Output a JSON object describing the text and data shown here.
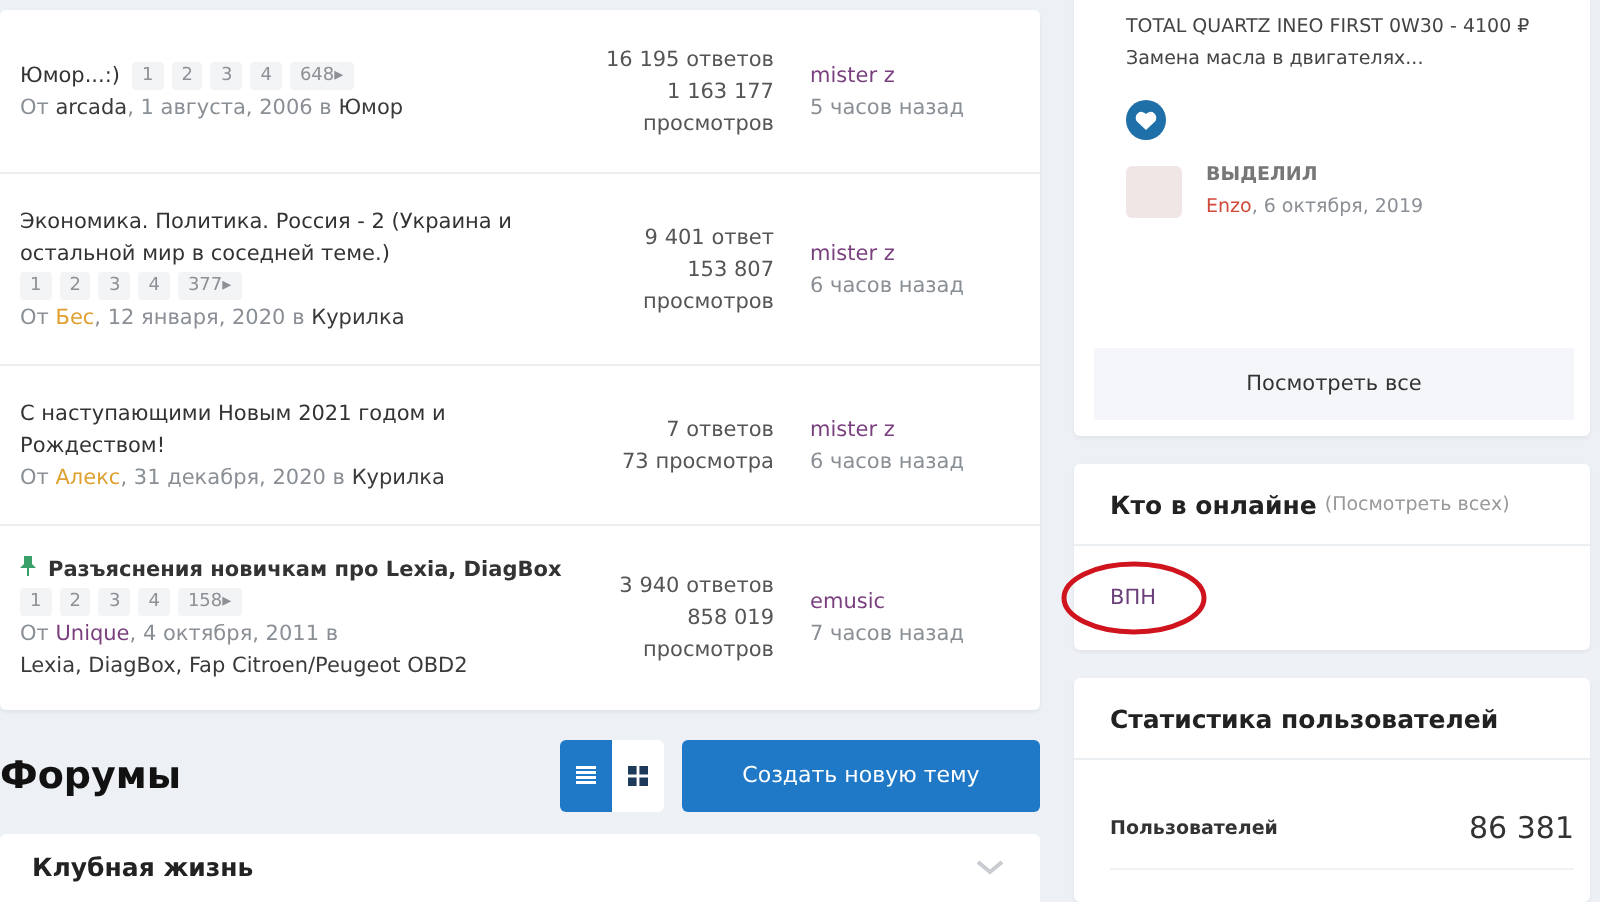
{
  "topics": [
    {
      "pinned": false,
      "title": "Юмор...:)",
      "pages": [
        "1",
        "2",
        "3",
        "4",
        "648▸"
      ],
      "by": "От",
      "author": "arcada",
      "color": "#3a3a3a",
      "date": ", 1 августа, 2006 в",
      "forum": "Юмор",
      "replies": "16 195 ответов",
      "views": "1 163 177 просмотров",
      "last_user": "mister z",
      "last_time": "5 часов назад"
    },
    {
      "pinned": false,
      "title": "Экономика. Политика. Россия - 2 (Украина и остальной мир в соседней теме.)",
      "pages": [
        "1",
        "2",
        "3",
        "4",
        "377▸"
      ],
      "by": "От",
      "author": "Бес",
      "color": "#e0a030",
      "date": ", 12 января, 2020 в",
      "forum": "Курилка",
      "replies": "9 401 ответ",
      "views": "153 807 просмотров",
      "last_user": "mister z",
      "last_time": "6 часов назад"
    },
    {
      "pinned": false,
      "title": "С наступающими Новым 2021 годом и Рождеством!",
      "by": "От",
      "author": "Алекс",
      "color": "#e0a030",
      "date": ", 31 декабря, 2020 в",
      "forum": "Курилка",
      "replies": "7 ответов",
      "views": "73 просмотра",
      "last_user": "mister z",
      "last_time": "6 часов назад"
    },
    {
      "pinned": true,
      "title": "Разъяснения новичкам про Lexia, DiagBox",
      "pages": [
        "1",
        "2",
        "3",
        "4",
        "158▸"
      ],
      "by": "От",
      "author": "Unique",
      "color": "#7a3f7f",
      "date": ", 4 октября, 2011 в",
      "forum": "Lexia, DiagBox, Fap Citroen/Peugeot OBD2",
      "replies": "3 940 ответов",
      "views": "858 019 просмотров",
      "last_user": "emusic",
      "last_time": "7 часов назад"
    }
  ],
  "forums_header": {
    "title": "Форумы",
    "view_modes": [
      {
        "kind": "list",
        "selected": true
      },
      {
        "kind": "grid",
        "selected": false
      }
    ],
    "create_button": "Создать новую тему"
  },
  "category": {
    "title": "Клубная жизнь"
  },
  "highlight": {
    "title": "TOTAL QUARTZ INEO FIRST 0W30 - 4100 ₽",
    "excerpt": "Замена масла в двигателях...",
    "label": "ВЫДЕЛИЛ",
    "user": "Enzo",
    "date": ", 6 октября, 2019",
    "button": "Посмотреть все"
  },
  "online": {
    "title": "Кто в онлайне",
    "link": "(Посмотреть всех)",
    "users": [
      "ВПН"
    ]
  },
  "stats": {
    "title": "Статистика пользователей",
    "rows": [
      {
        "label": "Пользователей",
        "value": "86 381"
      }
    ]
  }
}
